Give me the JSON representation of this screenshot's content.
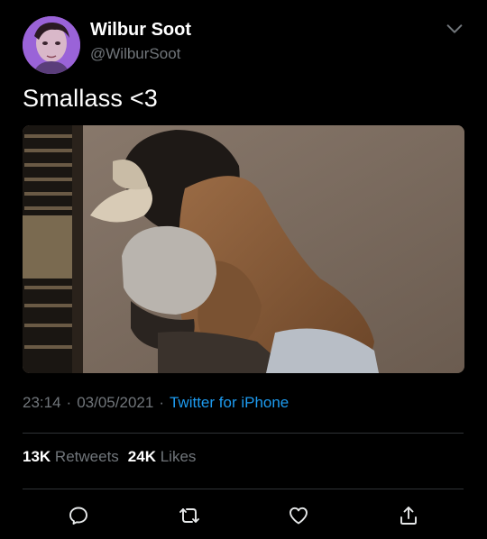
{
  "author": {
    "display_name": "Wilbur Soot",
    "handle": "@WilburSoot"
  },
  "tweet": {
    "text": "Smallass <3"
  },
  "meta": {
    "time": "23:14",
    "separator": "·",
    "date": "03/05/2021",
    "source": "Twitter for iPhone"
  },
  "stats": {
    "retweets_count": "13K",
    "retweets_label": "Retweets",
    "likes_count": "24K",
    "likes_label": "Likes"
  },
  "icons": {
    "more": "chevron-down-icon",
    "reply": "reply-icon",
    "retweet": "retweet-icon",
    "like": "heart-icon",
    "share": "share-icon"
  },
  "colors": {
    "background": "#000000",
    "text": "#ffffff",
    "secondary_text": "#71767b",
    "link": "#1d9bf0",
    "divider": "#2f3336"
  }
}
